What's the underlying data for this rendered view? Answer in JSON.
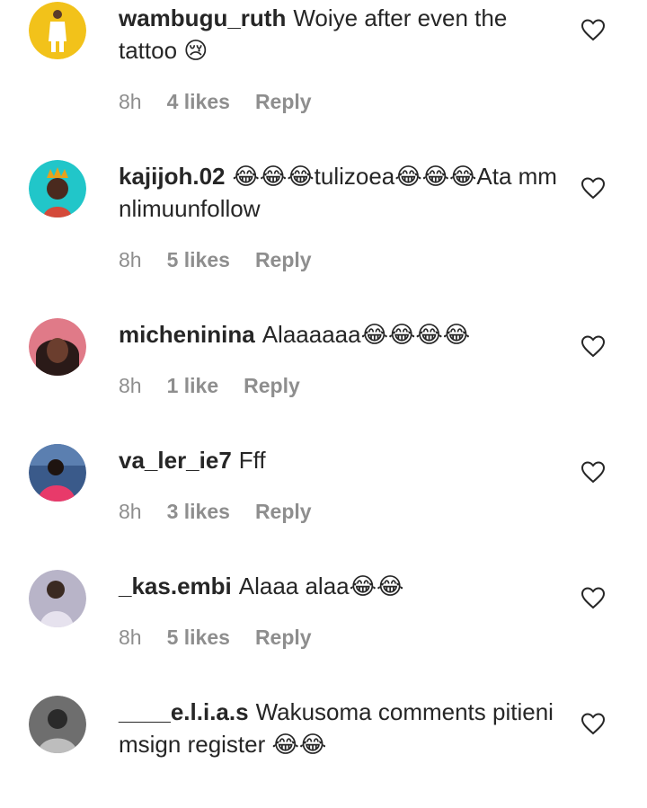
{
  "comments": [
    {
      "username": "wambugu_ruth",
      "text": "Woiye after even the tattoo 😢",
      "time": "8h",
      "likes": "4 likes",
      "reply": "Reply"
    },
    {
      "username": "kajijoh.02",
      "text": "😂😂😂tulizoea😂😂😂Ata mm nlimuunfollow",
      "time": "8h",
      "likes": "5 likes",
      "reply": "Reply"
    },
    {
      "username": "micheninina",
      "text": "Alaaaaaa😂😂😂😂",
      "time": "8h",
      "likes": "1 like",
      "reply": "Reply"
    },
    {
      "username": "va_ler_ie7",
      "text": "Fff",
      "time": "8h",
      "likes": "3 likes",
      "reply": "Reply"
    },
    {
      "username": "_kas.embi",
      "text": "Alaaa alaa😂😂",
      "time": "8h",
      "likes": "5 likes",
      "reply": "Reply"
    },
    {
      "username": "____e.l.i.a.s",
      "text": "Wakusoma comments pitieni msign register 😂😂",
      "time": "",
      "likes": "",
      "reply": ""
    }
  ],
  "icons": {
    "like": "heart-outline-icon"
  },
  "colors": {
    "text": "#262626",
    "meta": "#8e8e8e"
  }
}
